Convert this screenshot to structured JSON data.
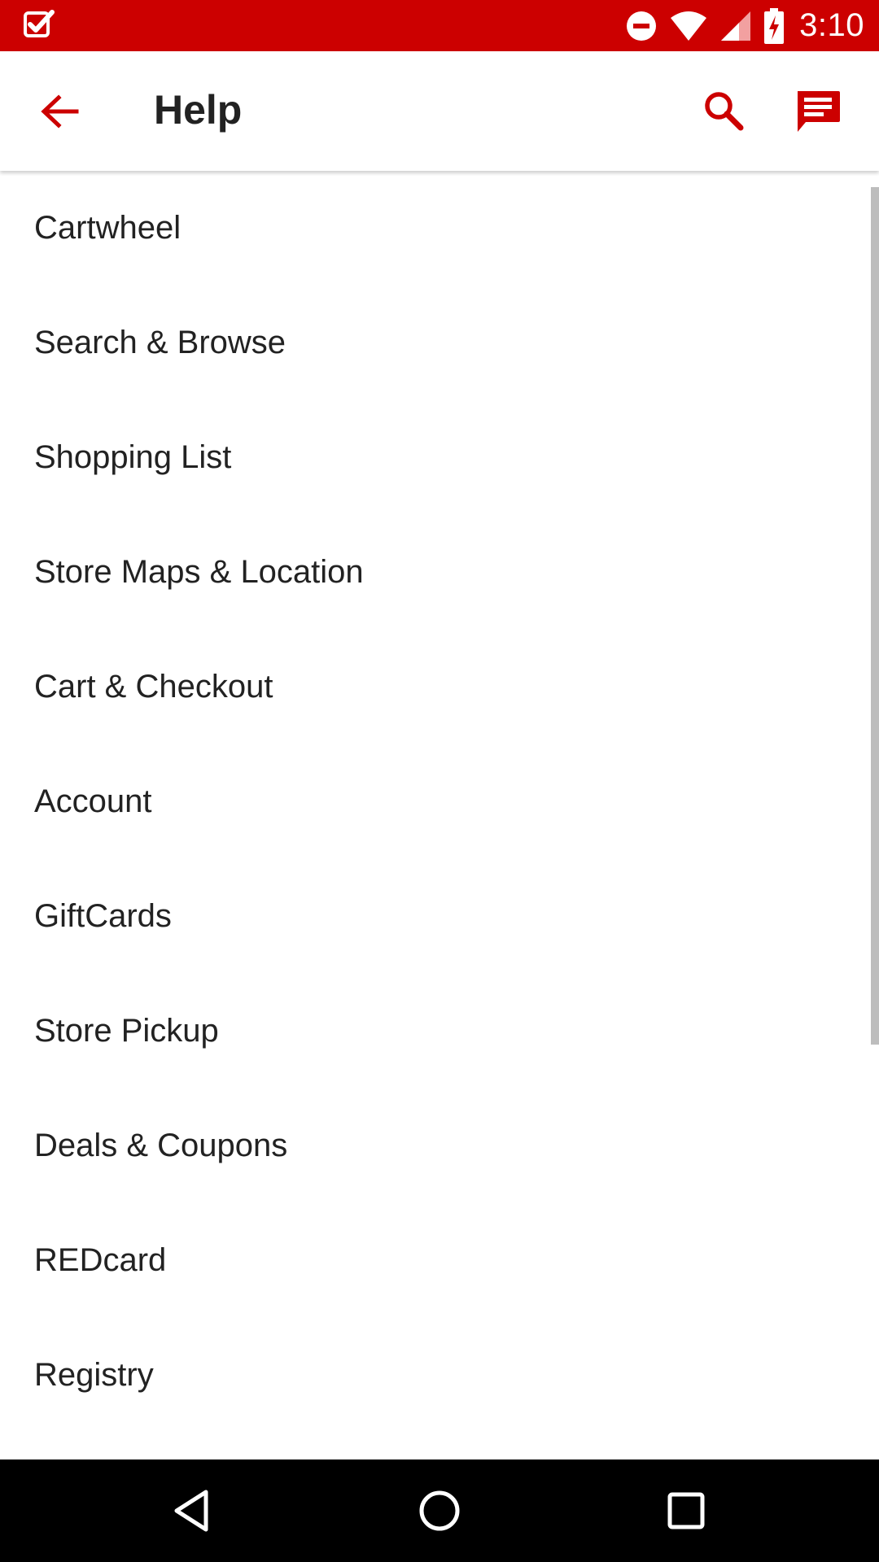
{
  "status_bar": {
    "time": "3:10",
    "background_color": "#cc0000",
    "icons": [
      "checkmark-notification-icon",
      "do-not-disturb-icon",
      "wifi-icon",
      "cell-signal-icon",
      "battery-charging-icon"
    ]
  },
  "app_bar": {
    "title": "Help",
    "accent_color": "#cc0000",
    "icons": [
      "back-arrow-icon",
      "search-icon",
      "chat-icon"
    ]
  },
  "help_topics": [
    {
      "label": "Cartwheel"
    },
    {
      "label": "Search & Browse"
    },
    {
      "label": "Shopping List"
    },
    {
      "label": "Store Maps & Location"
    },
    {
      "label": "Cart & Checkout"
    },
    {
      "label": "Account"
    },
    {
      "label": "GiftCards"
    },
    {
      "label": "Store Pickup"
    },
    {
      "label": "Deals & Coupons"
    },
    {
      "label": "REDcard"
    },
    {
      "label": "Registry"
    }
  ],
  "nav_bar": {
    "icons": [
      "nav-back-icon",
      "nav-home-icon",
      "nav-recents-icon"
    ]
  }
}
